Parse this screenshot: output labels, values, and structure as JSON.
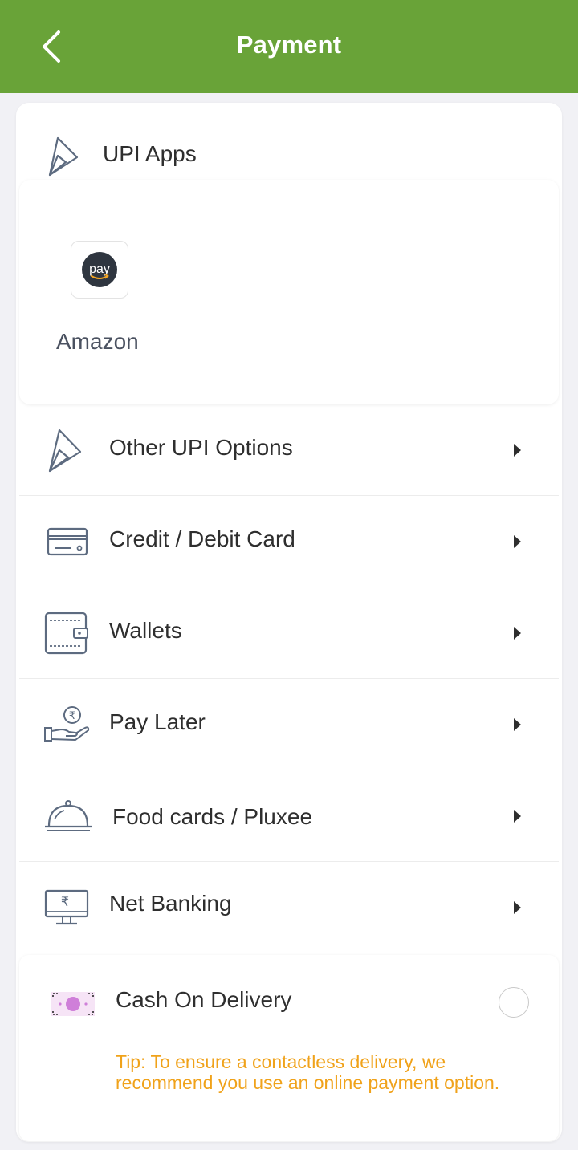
{
  "header": {
    "title": "Payment"
  },
  "upi": {
    "section_label": "UPI Apps",
    "apps": [
      {
        "label": "Amazon",
        "logo_text": "pay"
      }
    ]
  },
  "options": [
    {
      "label": "Other UPI Options",
      "icon": "upi-icon"
    },
    {
      "label": "Credit / Debit Card",
      "icon": "card-icon"
    },
    {
      "label": "Wallets",
      "icon": "wallet-icon"
    },
    {
      "label": "Pay Later",
      "icon": "pay-later-icon"
    },
    {
      "label": "Food cards / Pluxee",
      "icon": "cloche-icon"
    },
    {
      "label": "Net Banking",
      "icon": "monitor-icon"
    }
  ],
  "cod": {
    "label": "Cash On Delivery",
    "tip": "Tip: To ensure a contactless delivery, we recommend you use an online payment option."
  },
  "colors": {
    "header": "#69a338",
    "tip": "#f0a21a",
    "icon_stroke": "#5d6b80"
  }
}
